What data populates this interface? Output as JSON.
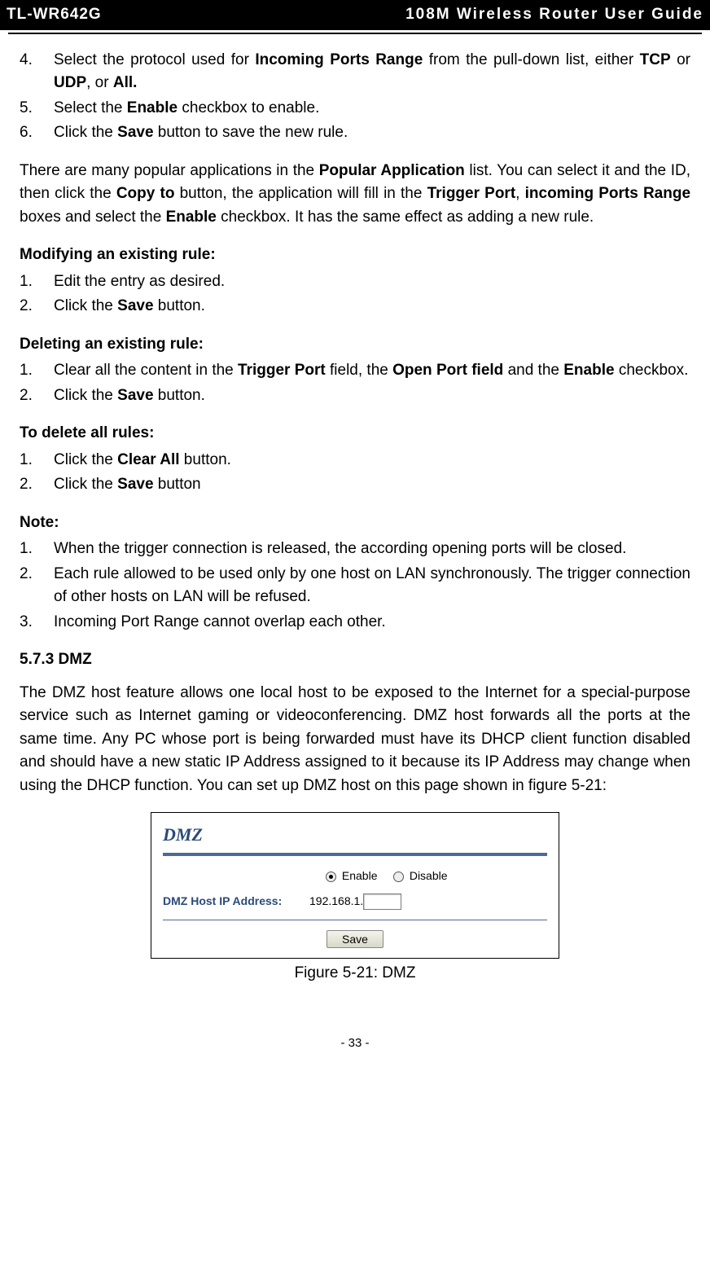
{
  "header": {
    "model": "TL-WR642G",
    "title": "108M Wireless Router User Guide"
  },
  "list1": {
    "i4_pre": "Select the protocol used for ",
    "i4_b1": "Incoming Ports Range",
    "i4_mid": " from the pull-down list, either ",
    "i4_b2": "TCP",
    "i4_mid2": " or ",
    "i4_b3": "UDP",
    "i4_mid3": ", or ",
    "i4_b4": "All.",
    "i5_pre": "Select the ",
    "i5_b1": "Enable",
    "i5_post": " checkbox to enable.",
    "i6_pre": "Click the ",
    "i6_b1": "Save",
    "i6_post": " button to save the new rule."
  },
  "para1": {
    "pre": "There are many popular applications in the ",
    "b1": "Popular Application",
    "mid1": " list. You can select it and the ID, then click the ",
    "b2": "Copy to",
    "mid2": " button, the application will fill in the ",
    "b3": "Trigger Port",
    "mid3": ", ",
    "b4": "incoming Ports Range",
    "mid4": " boxes and select the ",
    "b5": "Enable",
    "post": " checkbox. It has the same effect as adding a new rule."
  },
  "mod_heading": "Modifying an existing rule:",
  "list2": {
    "i1": "Edit the entry as desired.",
    "i2_pre": "Click the ",
    "i2_b": "Save",
    "i2_post": " button."
  },
  "del_heading": "Deleting an existing rule:",
  "list3": {
    "i1_pre": "Clear all the content in the ",
    "i1_b1": "Trigger Port",
    "i1_mid1": " field, the ",
    "i1_b2": "Open Port field",
    "i1_mid2": " and the ",
    "i1_b3": "Enable",
    "i1_post": " checkbox.",
    "i2_pre": "Click the ",
    "i2_b": "Save",
    "i2_post": " button."
  },
  "delall_heading": "To delete all rules:",
  "list4": {
    "i1_pre": "Click the ",
    "i1_b": "Clear All",
    "i1_post": " button.",
    "i2_pre": "Click the ",
    "i2_b": "Save",
    "i2_post": " button"
  },
  "note_heading": "Note:",
  "list5": {
    "i1": "When the trigger connection is released, the according opening ports will be closed.",
    "i2": "Each rule allowed to be used only by one host on LAN synchronously. The trigger connection of other hosts on LAN will be refused.",
    "i3": "Incoming Port Range cannot overlap each other."
  },
  "sec573": "5.7.3 DMZ",
  "dmz_para": "The DMZ host feature allows one local host to be exposed to the Internet for a special-purpose service such as Internet gaming or videoconferencing. DMZ host forwards all the ports at the same time. Any PC whose port is being forwarded must have its DHCP client function disabled and should have a new static IP Address assigned to it because its IP Address may change when using the DHCP function. You can set up DMZ host on this page shown in figure 5-21:",
  "figure": {
    "title": "DMZ",
    "enable": "Enable",
    "disable": "Disable",
    "ip_label": "DMZ Host IP Address:",
    "ip_prefix": "192.168.1.",
    "save": "Save"
  },
  "fig_caption": "Figure 5-21: DMZ",
  "page_num": "- 33 -"
}
